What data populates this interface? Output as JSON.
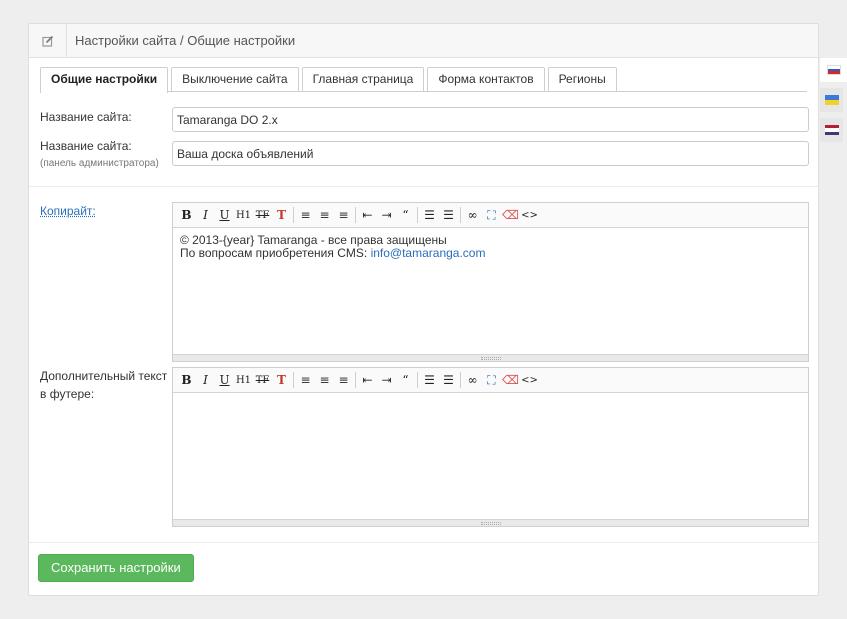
{
  "header": {
    "icon": "edit-icon",
    "title": "Настройки сайта / Общие настройки"
  },
  "tabs": [
    {
      "label": "Общие настройки",
      "active": true
    },
    {
      "label": "Выключение сайта",
      "active": false
    },
    {
      "label": "Главная страница",
      "active": false
    },
    {
      "label": "Форма контактов",
      "active": false
    },
    {
      "label": "Регионы",
      "active": false
    }
  ],
  "form": {
    "site_name": {
      "label": "Название сайта:",
      "value": "Tamaranga DO 2.x"
    },
    "site_name_admin": {
      "label": "Название сайта:",
      "sublabel": "(панель администратора)",
      "value": "Ваша доска объявлений"
    },
    "copyright": {
      "label": "Копирайт:",
      "line1": "© 2013-{year} Tamaranga - все права защищены",
      "line2_text": "По вопросам приобретения CMS: ",
      "line2_email": "info@tamaranga.com"
    },
    "footer_text": {
      "label_line1": "Дополнительный текст",
      "label_line2": "в футере:",
      "value": ""
    }
  },
  "toolbar_buttons": [
    {
      "name": "bold-icon",
      "glyph": "B"
    },
    {
      "name": "italic-icon",
      "glyph": "I"
    },
    {
      "name": "underline-icon",
      "glyph": "U"
    },
    {
      "name": "heading-icon",
      "glyph": "H1"
    },
    {
      "name": "clear-format-icon",
      "glyph": "TF"
    },
    {
      "name": "text-color-icon",
      "glyph": "T"
    },
    {
      "name": "align-left-icon",
      "glyph": "≡"
    },
    {
      "name": "align-center-icon",
      "glyph": "≡"
    },
    {
      "name": "align-right-icon",
      "glyph": "≡"
    },
    {
      "name": "outdent-icon",
      "glyph": "⇤"
    },
    {
      "name": "indent-icon",
      "glyph": "⇥"
    },
    {
      "name": "quote-icon",
      "glyph": "“"
    },
    {
      "name": "ordered-list-icon",
      "glyph": "☰"
    },
    {
      "name": "unordered-list-icon",
      "glyph": "☰"
    },
    {
      "name": "link-icon",
      "glyph": "∞"
    },
    {
      "name": "fullscreen-icon",
      "glyph": "⛶"
    },
    {
      "name": "eraser-icon",
      "glyph": "⌫"
    },
    {
      "name": "source-code-icon",
      "glyph": "<>"
    }
  ],
  "save_button": {
    "label": "Сохранить настройки"
  },
  "languages": [
    {
      "name": "flag-ru-icon",
      "colors": [
        "#ffffff",
        "#2a5bd7",
        "#d52b1e"
      ],
      "active": true
    },
    {
      "name": "flag-ua-icon",
      "colors": [
        "#3b7bd6",
        "#f3d02f"
      ],
      "active": false
    },
    {
      "name": "flag-us-icon",
      "colors": [
        "#b22234",
        "#ffffff",
        "#3c3b6e"
      ],
      "active": false
    }
  ],
  "colors": {
    "save_button": "#5cb85c",
    "link": "#2a6ebb"
  }
}
